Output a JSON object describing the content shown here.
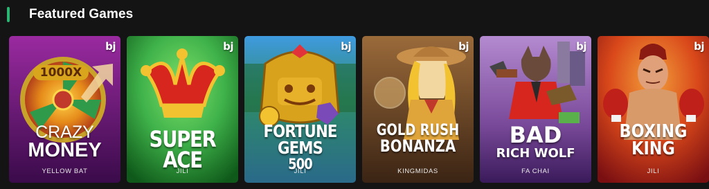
{
  "section": {
    "title": "Featured Games",
    "accent_color": "#2bb673"
  },
  "cards": [
    {
      "title_lines": [
        "CRAZY",
        "MONEY"
      ],
      "art_text": "1000X",
      "provider": "YELLOW BAT",
      "badge": "bj",
      "art_colors": [
        "#8a1f8f",
        "#3a0b4a"
      ]
    },
    {
      "title_lines": [
        "SUPER ACE"
      ],
      "provider": "JILI",
      "badge": "bj",
      "art_colors": [
        "#3fb24a",
        "#0f5a1a"
      ]
    },
    {
      "title_lines": [
        "FORTUNE GEMS",
        "500"
      ],
      "provider": "JILI",
      "badge": "bj",
      "art_colors": [
        "#2e8a7a",
        "#1b4f6b"
      ]
    },
    {
      "title_lines": [
        "GOLD RUSH",
        "BONANZA"
      ],
      "provider": "KINGMIDAS",
      "badge": "bj",
      "art_colors": [
        "#8a5a2e",
        "#3b2414"
      ]
    },
    {
      "title_lines": [
        "BAD",
        "RICH WOLF"
      ],
      "provider": "FA CHAI",
      "badge": "bj",
      "art_colors": [
        "#9a6fbf",
        "#4a2a6a"
      ]
    },
    {
      "title_lines": [
        "BOXING",
        "KING"
      ],
      "provider": "JILI",
      "badge": "bj",
      "art_colors": [
        "#e05a1a",
        "#8a0f12"
      ]
    }
  ]
}
